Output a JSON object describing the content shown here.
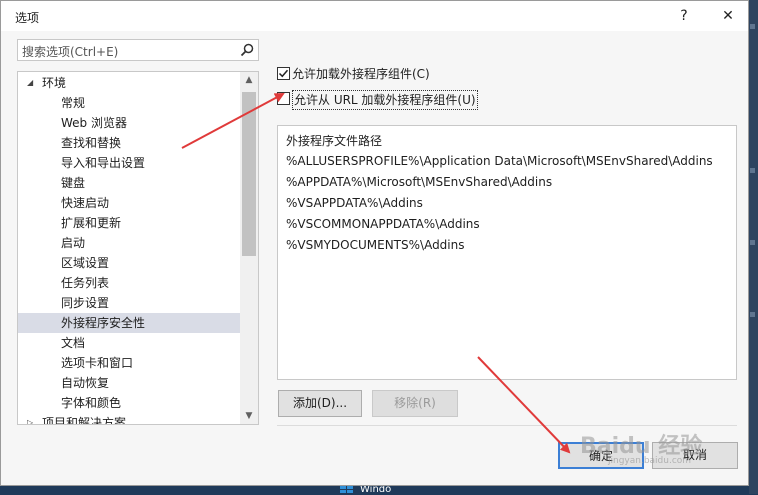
{
  "window": {
    "title": "选项",
    "help_label": "?",
    "close_label": "✕"
  },
  "search": {
    "placeholder": "搜索选项(Ctrl+E)"
  },
  "tree": {
    "items": [
      {
        "label": "环境",
        "arrow": "◢"
      },
      {
        "label": "常规"
      },
      {
        "label": "Web 浏览器"
      },
      {
        "label": "查找和替换"
      },
      {
        "label": "导入和导出设置"
      },
      {
        "label": "键盘"
      },
      {
        "label": "快速启动"
      },
      {
        "label": "扩展和更新"
      },
      {
        "label": "启动"
      },
      {
        "label": "区域设置"
      },
      {
        "label": "任务列表"
      },
      {
        "label": "同步设置"
      },
      {
        "label": "外接程序安全性",
        "selected": true
      },
      {
        "label": "文档"
      },
      {
        "label": "选项卡和窗口"
      },
      {
        "label": "自动恢复"
      },
      {
        "label": "字体和颜色"
      },
      {
        "label": "项目和解决方案",
        "arrow": "▷"
      }
    ]
  },
  "options": {
    "allow_load": {
      "label": "允许加载外接程序组件(C)",
      "checked": true
    },
    "allow_url": {
      "label": "允许从 URL 加载外接程序组件(U)",
      "checked": false
    }
  },
  "paths": {
    "header": "外接程序文件路径",
    "items": [
      "%ALLUSERSPROFILE%\\Application Data\\Microsoft\\MSEnvShared\\Addins",
      "%APPDATA%\\Microsoft\\MSEnvShared\\Addins",
      "%VSAPPDATA%\\Addins",
      "%VSCOMMONAPPDATA%\\Addins",
      "%VSMYDOCUMENTS%\\Addins"
    ]
  },
  "buttons": {
    "add": "添加(D)...",
    "remove": "移除(R)",
    "ok": "确定",
    "cancel": "取消"
  },
  "watermark": {
    "main": "Baidu 经验",
    "sub": "jingyan.baidu.com"
  },
  "taskbar": {
    "text": "Windo"
  },
  "colors": {
    "selection": "#d9dce6",
    "accent": "#3c7fd5",
    "annotation_arrow": "#e03a3a"
  }
}
